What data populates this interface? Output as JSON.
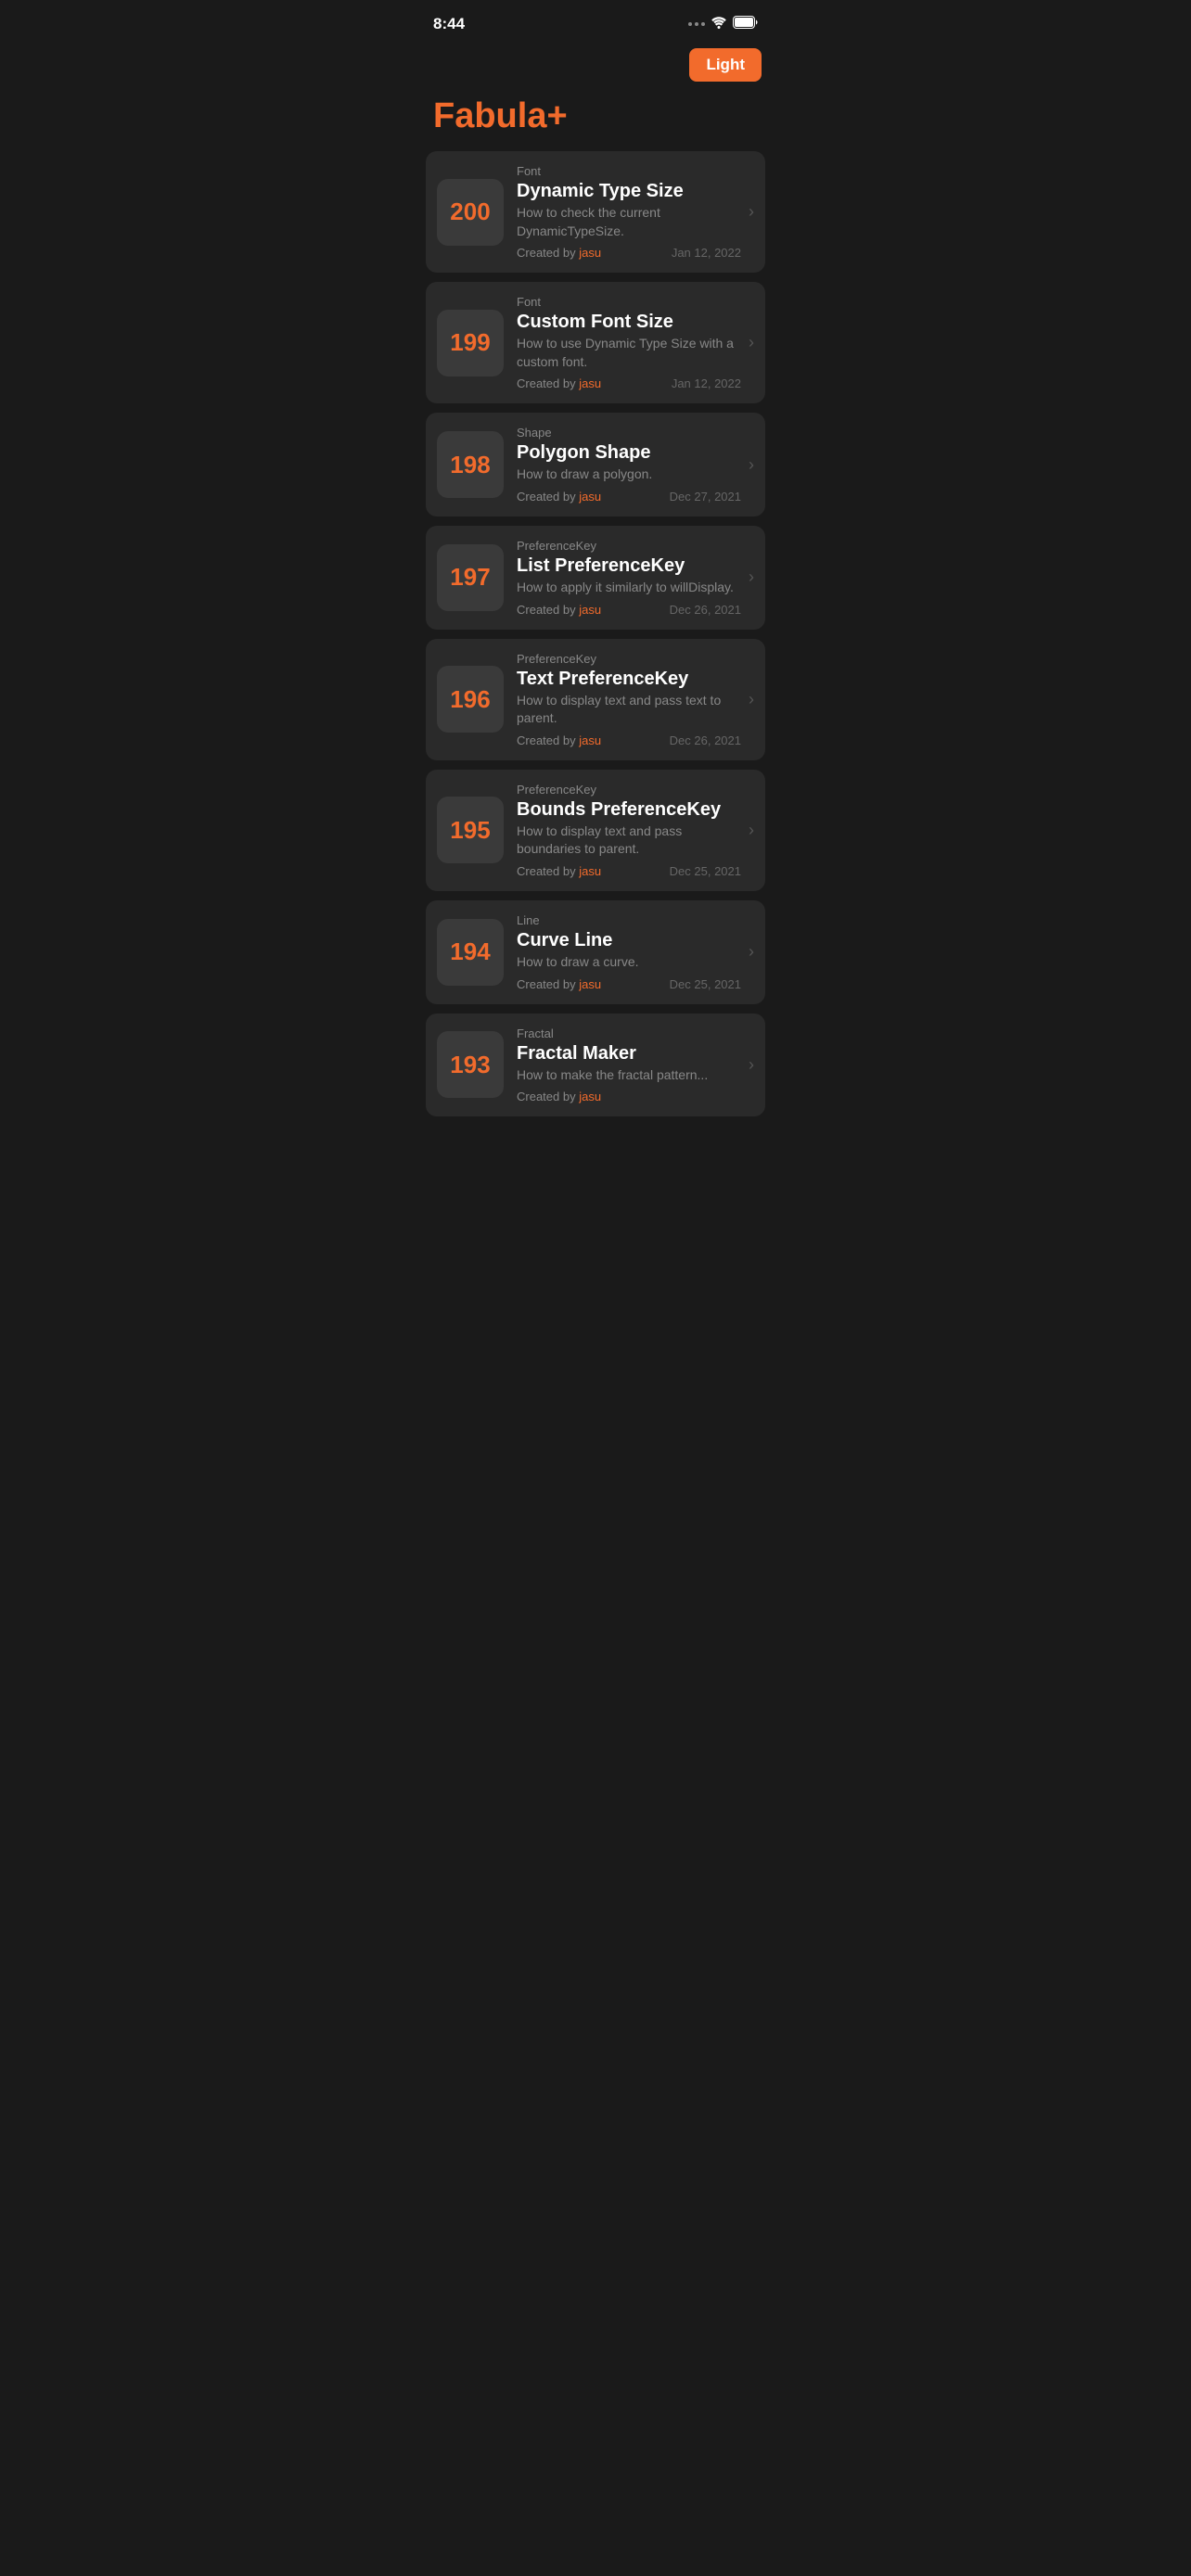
{
  "statusBar": {
    "time": "8:44"
  },
  "header": {
    "lightButton": "Light"
  },
  "appTitle": "Fabula+",
  "items": [
    {
      "id": 200,
      "category": "Font",
      "title": "Dynamic Type Size",
      "description": "How to check the current DynamicTypeSize.",
      "author": "jasu",
      "date": "Jan 12, 2022"
    },
    {
      "id": 199,
      "category": "Font",
      "title": "Custom Font Size",
      "description": "How to use Dynamic Type Size with a custom font.",
      "author": "jasu",
      "date": "Jan 12, 2022"
    },
    {
      "id": 198,
      "category": "Shape",
      "title": "Polygon Shape",
      "description": "How to draw a polygon.",
      "author": "jasu",
      "date": "Dec 27, 2021"
    },
    {
      "id": 197,
      "category": "PreferenceKey",
      "title": "List PreferenceKey",
      "description": "How to apply it similarly to willDisplay.",
      "author": "jasu",
      "date": "Dec 26, 2021"
    },
    {
      "id": 196,
      "category": "PreferenceKey",
      "title": "Text PreferenceKey",
      "description": "How to display text and pass text to parent.",
      "author": "jasu",
      "date": "Dec 26, 2021"
    },
    {
      "id": 195,
      "category": "PreferenceKey",
      "title": "Bounds PreferenceKey",
      "description": "How to display text and pass boundaries to parent.",
      "author": "jasu",
      "date": "Dec 25, 2021"
    },
    {
      "id": 194,
      "category": "Line",
      "title": "Curve Line",
      "description": "How to draw a curve.",
      "author": "jasu",
      "date": "Dec 25, 2021"
    },
    {
      "id": 193,
      "category": "Fractal",
      "title": "Fractal Maker",
      "description": "How to make the fractal pattern...",
      "author": "jasu",
      "date": ""
    }
  ],
  "labels": {
    "createdBy": "Created by"
  }
}
